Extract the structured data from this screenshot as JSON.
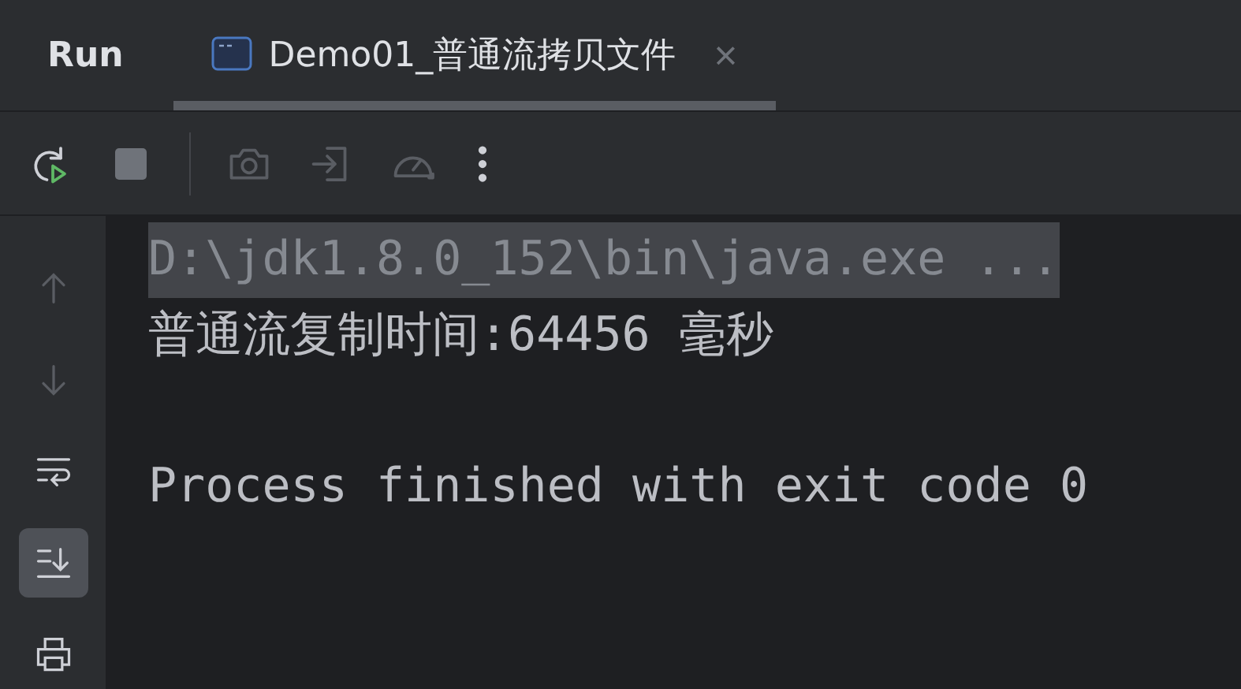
{
  "panel": {
    "title": "Run"
  },
  "tabs": [
    {
      "label": "Demo01_普通流拷贝文件",
      "selected": true,
      "close": "×"
    }
  ],
  "toolbar": [
    {
      "kind": "rerun",
      "disabled": false
    },
    {
      "kind": "stop",
      "disabled": true
    },
    {
      "kind": "camera",
      "disabled": true
    },
    {
      "kind": "exit",
      "disabled": true
    },
    {
      "kind": "gauge",
      "disabled": true
    },
    {
      "kind": "more",
      "disabled": false
    }
  ],
  "sidebar": {
    "items": [
      {
        "kind": "up",
        "disabled": true,
        "selected": false
      },
      {
        "kind": "down",
        "disabled": true,
        "selected": false
      },
      {
        "kind": "wrap",
        "disabled": false,
        "selected": false
      },
      {
        "kind": "scroll-end",
        "disabled": false,
        "selected": true
      },
      {
        "kind": "print",
        "disabled": false,
        "selected": false
      }
    ]
  },
  "console": {
    "lines": [
      {
        "kind": "command",
        "text": "D:\\jdk1.8.0_152\\bin\\java.exe ..."
      },
      {
        "kind": "output",
        "text": "普通流复制时间:64456 毫秒"
      },
      {
        "kind": "exit",
        "text": "Process finished with exit code 0"
      }
    ]
  }
}
